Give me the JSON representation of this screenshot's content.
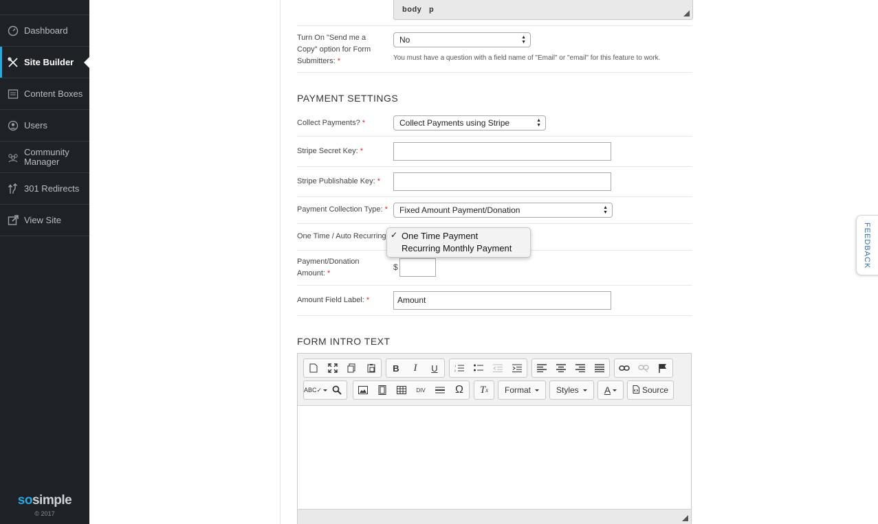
{
  "sidebar": {
    "items": [
      {
        "label": "Dashboard",
        "icon": "dashboard-icon"
      },
      {
        "label": "Site Builder",
        "icon": "tools-icon"
      },
      {
        "label": "Content Boxes",
        "icon": "content-boxes-icon"
      },
      {
        "label": "Users",
        "icon": "user-icon"
      },
      {
        "label": "Community Manager",
        "icon": "community-icon"
      },
      {
        "label": "301 Redirects",
        "icon": "redirect-icon"
      },
      {
        "label": "View Site",
        "icon": "external-link-icon"
      }
    ],
    "brand": {
      "so": "so",
      "simple": "simple",
      "copyright": "© 2017"
    }
  },
  "editor_top": {
    "path_body": "body",
    "path_p": "p"
  },
  "send_copy": {
    "label": "Turn On \"Send me a Copy\" option for Form Submitters:",
    "required": "*",
    "value": "No",
    "hint": "You must have a question with a field name of \"Email\" or \"email\" for this feature to work."
  },
  "payment": {
    "title": "PAYMENT SETTINGS",
    "collect_label": "Collect Payments?",
    "collect_value": "Collect Payments using Stripe",
    "secret_label": "Stripe Secret Key:",
    "secret_value": "",
    "publishable_label": "Stripe Publishable Key:",
    "publishable_value": "",
    "type_label": "Payment Collection Type:",
    "type_value": "Fixed Amount Payment/Donation",
    "recurring_label": "One Time / Auto Recurring:",
    "recurring_options": [
      "One Time Payment",
      "Recurring Monthly Payment"
    ],
    "recurring_selected": "One Time Payment",
    "amount_label": "Payment/Donation Amount:",
    "amount_currency": "$",
    "amount_value": "",
    "amount_field_label": "Amount Field Label:",
    "amount_field_value": "Amount",
    "required": "*"
  },
  "intro": {
    "title": "FORM INTRO TEXT",
    "format_label": "Format",
    "styles_label": "Styles",
    "source_label": "Source"
  },
  "feedback": {
    "label": "FEEDBACK"
  },
  "colors": {
    "sidebar_bg": "#1e2226",
    "accent": "#2ba6de",
    "required": "#d9242b"
  }
}
